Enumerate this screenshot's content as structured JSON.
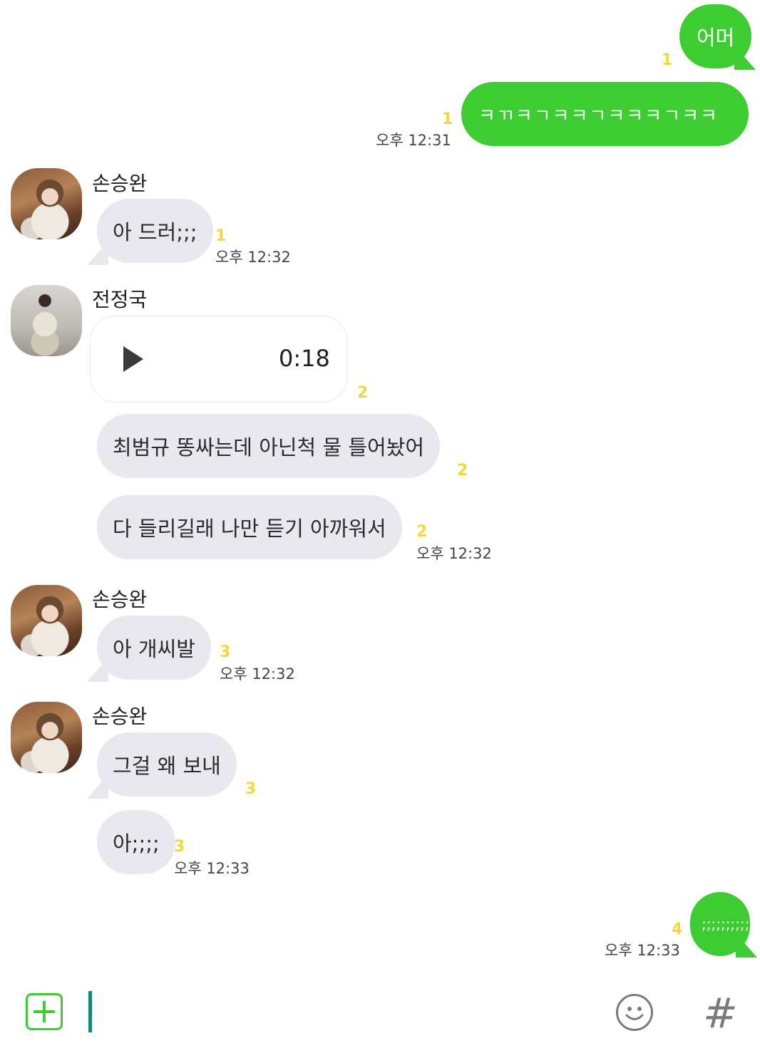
{
  "messages": [
    {
      "text": "어머",
      "read": "1"
    },
    {
      "text": "ㅋㄲㅋㄱㅋㅋㄱㅋㅋㅋㄱㅋㅋ",
      "read": "1",
      "time": "오후 12:31"
    },
    {
      "sender": "손승완",
      "text": "아 드러;;;",
      "read": "1",
      "time": "오후 12:32"
    },
    {
      "sender": "전정국",
      "voice_duration": "0:18",
      "read": "2"
    },
    {
      "text": "최범규 똥싸는데 아닌척 물 틀어놨어",
      "read": "2"
    },
    {
      "text": "다 들리길래 나만 듣기 아까워서",
      "read": "2",
      "time": "오후 12:32"
    },
    {
      "sender": "손승완",
      "text": "아 개씨발",
      "read": "3",
      "time": "오후 12:32"
    },
    {
      "sender": "손승완",
      "text": "그걸 왜 보내",
      "read": "3"
    },
    {
      "text": "아;;;;",
      "read": "3",
      "time": "오후 12:33"
    },
    {
      "text": ";;;;;;;;;;",
      "read": "4",
      "time": "오후 12:33"
    }
  ],
  "input": {
    "plus_label": "+",
    "hash_label": "#",
    "emoji_icon": "smiley-icon"
  },
  "colors": {
    "outgoing": "#3dcd33",
    "incoming": "#e8e8ee",
    "read_count": "#f4d83a"
  }
}
